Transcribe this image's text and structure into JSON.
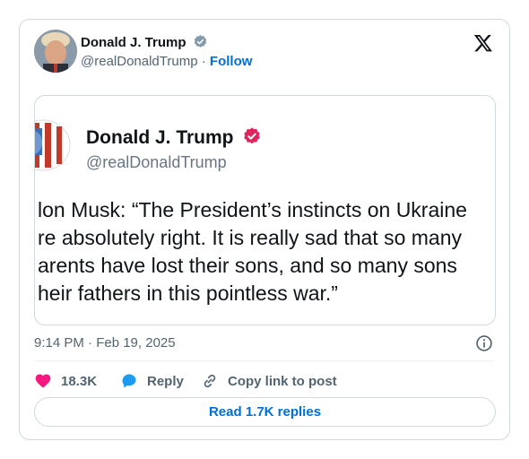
{
  "embed": {
    "author": {
      "name": "Donald J. Trump",
      "handle": "@realDonaldTrump",
      "separator": "·",
      "follow_label": "Follow",
      "verified_badge": "gray-check-badge"
    },
    "platform_icon": "x-logo-icon",
    "quoted": {
      "name": "Donald J. Trump",
      "handle": "@realDonaldTrump",
      "verified_badge": "pink-check-badge",
      "lines": [
        "lon Musk: “The President’s instincts on Ukraine",
        "re absolutely right. It is really sad that so many",
        "arents have lost their sons, and so many sons",
        "heir fathers in this pointless war.”"
      ]
    },
    "timestamp": "9:14 PM · Feb 19, 2025",
    "info_icon": "info-icon",
    "actions": {
      "like_count": "18.3K",
      "reply_label": "Reply",
      "copy_label": "Copy link to post"
    },
    "read_replies_label": "Read 1.7K replies",
    "colors": {
      "like": "#f91880",
      "reply": "#1d9bf0",
      "link": "#006fd6",
      "badge_quote": "#e0245e",
      "border": "#cfd9de"
    }
  }
}
